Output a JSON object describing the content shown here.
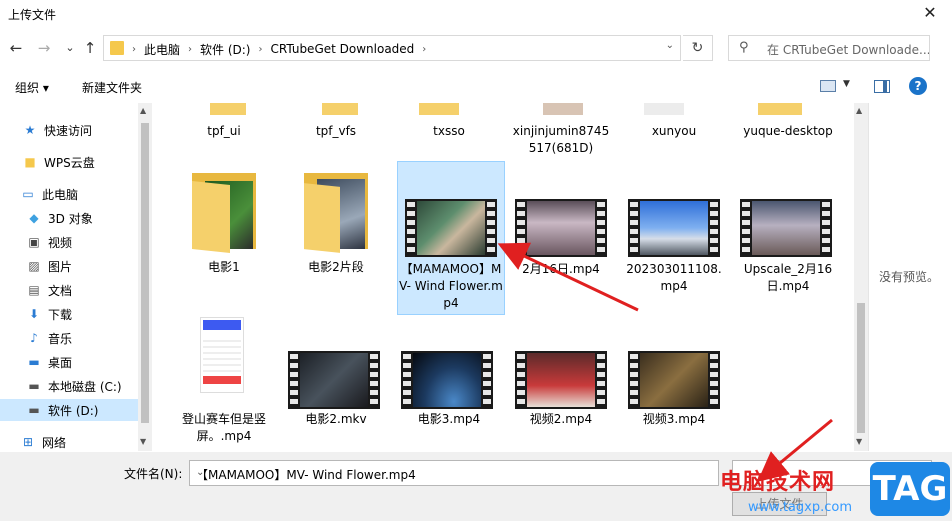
{
  "window": {
    "title": "上传文件",
    "close_glyph": "✕"
  },
  "nav": {
    "back": "←",
    "forward": "→",
    "recent": "⌄",
    "up": "↑"
  },
  "breadcrumb": {
    "items": [
      "此电脑",
      "软件 (D:)",
      "CRTubeGet Downloaded"
    ],
    "sep": "›",
    "dropdown": "⌄",
    "refresh": "↻"
  },
  "search": {
    "placeholder": "在 CRTubeGet Downloade...",
    "icon": "⚲"
  },
  "toolbar": {
    "organize": "组织 ▾",
    "new_folder": "新建文件夹",
    "view_dd": "▼",
    "help": "?"
  },
  "sidebar": {
    "items": [
      {
        "label": "快速访问",
        "icon": "star-icon",
        "glyph": "★",
        "color": "#2b7cd3"
      },
      {
        "label": "WPS云盘",
        "icon": "folder-icon",
        "glyph": "■",
        "color": "#f5c84c"
      },
      {
        "label": "此电脑",
        "icon": "computer-icon",
        "glyph": "▭",
        "color": "#2b7cd3"
      },
      {
        "label": "3D 对象",
        "icon": "cube-icon",
        "glyph": "◆",
        "color": "#3ea1e0"
      },
      {
        "label": "视频",
        "icon": "video-icon",
        "glyph": "▣",
        "color": "#444"
      },
      {
        "label": "图片",
        "icon": "picture-icon",
        "glyph": "▨",
        "color": "#555"
      },
      {
        "label": "文档",
        "icon": "document-icon",
        "glyph": "▤",
        "color": "#555"
      },
      {
        "label": "下载",
        "icon": "download-icon",
        "glyph": "⬇",
        "color": "#2b7cd3"
      },
      {
        "label": "音乐",
        "icon": "music-icon",
        "glyph": "♪",
        "color": "#2b7cd3"
      },
      {
        "label": "桌面",
        "icon": "desktop-icon",
        "glyph": "▬",
        "color": "#2b7cd3"
      },
      {
        "label": "本地磁盘 (C:)",
        "icon": "drive-icon",
        "glyph": "▬",
        "color": "#555"
      },
      {
        "label": "软件 (D:)",
        "icon": "drive-icon",
        "glyph": "▬",
        "color": "#555"
      },
      {
        "label": "网络",
        "icon": "network-icon",
        "glyph": "⊞",
        "color": "#2b7cd3"
      }
    ]
  },
  "files": {
    "row0": [
      "tpf_ui",
      "tpf_vfs",
      "txsso",
      "xinjinjumin8745517(681D)",
      "xunyou",
      "yuque-desktop"
    ],
    "row1": [
      "电影1",
      "电影2片段",
      "【MAMAMOO】MV- Wind Flower.mp4",
      "2月16日.mp4",
      "202303011108.mp4",
      "Upscale_2月16日.mp4"
    ],
    "row2": [
      "登山赛车但是竖屏。.mp4",
      "电影2.mkv",
      "电影3.mp4",
      "视频2.mp4",
      "视频3.mp4"
    ]
  },
  "preview": {
    "text": "没有预览。"
  },
  "bottom": {
    "filename_label": "文件名(N):",
    "filename_value": "【MAMAMOO】MV- Wind Flower.mp4",
    "filename_dd": "⌄",
    "upload_button": "上传文件"
  },
  "watermark": {
    "cn": "电脑技术网",
    "url": "www.tagxp.com",
    "tag": "TAG"
  },
  "colors": {
    "accent": "#1a73c9",
    "selection": "#cce8ff",
    "annotation": "#e02020"
  }
}
